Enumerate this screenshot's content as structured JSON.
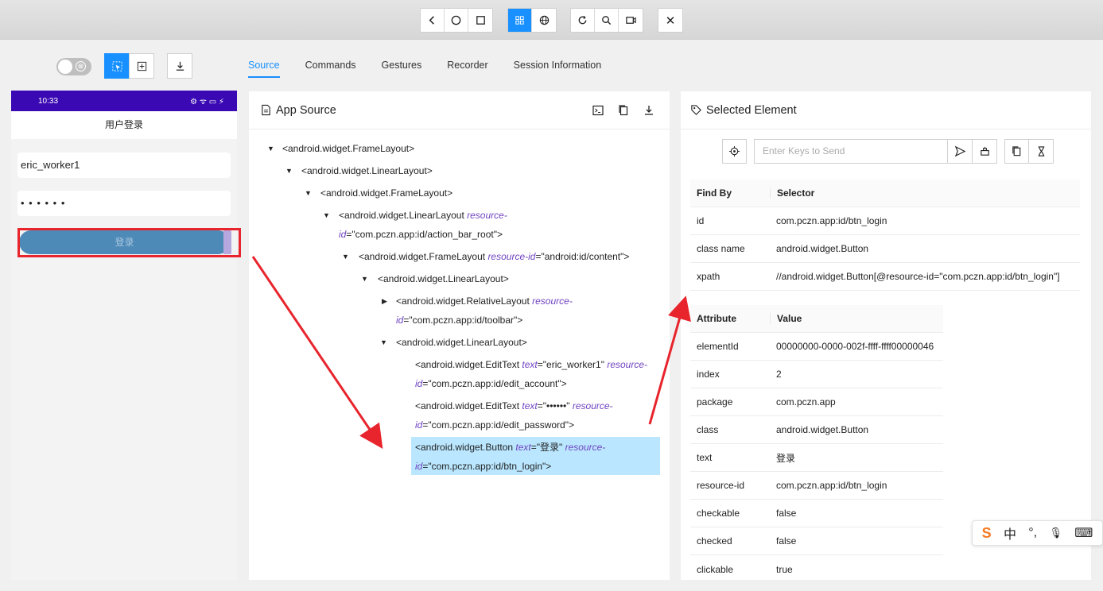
{
  "toolbar": {
    "groups": [
      [
        "back-icon",
        "home-icon",
        "square-icon"
      ],
      [
        "grid-icon",
        "globe-icon"
      ],
      [
        "refresh-icon",
        "search-icon",
        "record-icon"
      ],
      [
        "close-icon"
      ]
    ],
    "close_glyph": "✕"
  },
  "left_controls": {
    "toggle_icon": "⊗"
  },
  "tabs": [
    "Source",
    "Commands",
    "Gestures",
    "Recorder",
    "Session Information"
  ],
  "phone": {
    "status_time": "10:33",
    "status_right": "⚙ ᯤ ▭ ⚡",
    "title": "用户登录",
    "username": "eric_worker1",
    "password": "• • • • • •",
    "login_label": "登录"
  },
  "app_source": {
    "title": "App Source",
    "nodes": [
      {
        "line1": "<android.widget.FrameLayout>"
      },
      {
        "line1": "<android.widget.LinearLayout>"
      },
      {
        "line1": "<android.widget.FrameLayout>"
      },
      {
        "tag": "<android.widget.LinearLayout ",
        "attr1": "resource-",
        "attr1b": "id",
        "val": "=\"com.pczn.app:id/action_bar_root\">"
      },
      {
        "tag": "<android.widget.FrameLayout ",
        "attr1": "resource-id",
        "val": "=\"android:id/content\">"
      },
      {
        "line1": "<android.widget.LinearLayout>"
      },
      {
        "tag": "<android.widget.RelativeLayout ",
        "attr1": "resource-",
        "attr1b": "id",
        "val": "=\"com.pczn.app:id/toolbar\">"
      },
      {
        "line1": "<android.widget.LinearLayout>"
      },
      {
        "tag": "<android.widget.EditText ",
        "attr1": "text",
        "val1": "=\"eric_worker1\" ",
        "attr2": "resource-",
        "attr2b": "id",
        "val": "=\"com.pczn.app:id/edit_account\">"
      },
      {
        "tag": "<android.widget.EditText ",
        "attr1": "text",
        "val1": "=\"••••••\" ",
        "attr2": "resource-",
        "attr2b": "id",
        "val": "=\"com.pczn.app:id/edit_password\">"
      },
      {
        "tag": "<android.widget.Button ",
        "attr1": "text",
        "val1": "=\"登录\" ",
        "attr2": "resource-",
        "attr2b": "id",
        "val": "=\"com.pczn.app:id/btn_login\">"
      }
    ]
  },
  "selected": {
    "title": "Selected Element",
    "send_placeholder": "Enter Keys to Send",
    "findby_headers": [
      "Find By",
      "Selector"
    ],
    "findby": [
      [
        "id",
        "com.pczn.app:id/btn_login"
      ],
      [
        "class name",
        "android.widget.Button"
      ],
      [
        "xpath",
        "//android.widget.Button[@resource-id=\"com.pczn.app:id/btn_login\"]"
      ]
    ],
    "attr_headers": [
      "Attribute",
      "Value"
    ],
    "attrs": [
      [
        "elementId",
        "00000000-0000-002f-ffff-ffff00000046"
      ],
      [
        "index",
        "2"
      ],
      [
        "package",
        "com.pczn.app"
      ],
      [
        "class",
        "android.widget.Button"
      ],
      [
        "text",
        "登录"
      ],
      [
        "resource-id",
        "com.pczn.app:id/btn_login"
      ],
      [
        "checkable",
        "false"
      ],
      [
        "checked",
        "false"
      ],
      [
        "clickable",
        "true"
      ]
    ]
  },
  "ime": {
    "logo": "S",
    "lang": "中",
    "punct": "°,",
    "mic": "🎙",
    "keyboard": "⌨"
  },
  "colors": {
    "accent": "#1890ff",
    "highlight": "#e8242c",
    "selected_row": "#bae7ff",
    "statusbar": "#3a09b3"
  }
}
